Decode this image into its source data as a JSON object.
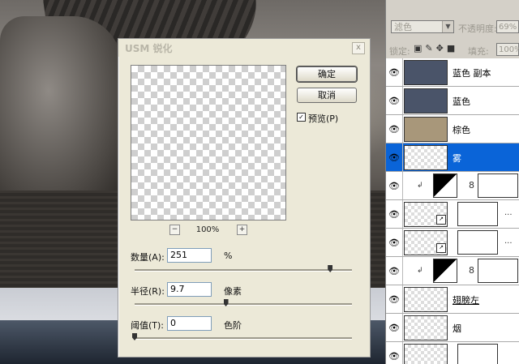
{
  "dialog": {
    "title": "USM 锐化",
    "close_label": "x",
    "ok_label": "确定",
    "cancel_label": "取消",
    "preview_label": "预览(P)",
    "preview_checked": true,
    "zoom_minus": "−",
    "zoom_plus": "+",
    "zoom_value": "100%",
    "amount": {
      "label": "数量(A):",
      "value": "251",
      "unit": "%",
      "slider_fraction": 0.9
    },
    "radius": {
      "label": "半径(R):",
      "value": "9.7",
      "unit": "像素",
      "slider_fraction": 0.42
    },
    "threshold": {
      "label": "阈值(T):",
      "value": "0",
      "unit": "色阶",
      "slider_fraction": 0.0
    }
  },
  "layers_panel": {
    "blend_mode": "滤色",
    "opacity_label": "不透明度:",
    "opacity_value": "69%",
    "lock_label": "锁定:",
    "fill_label": "填充:",
    "fill_value": "100%",
    "layers": [
      {
        "name": "蓝色 副本",
        "thumb_color": "#4a5469",
        "selected": false
      },
      {
        "name": "蓝色",
        "thumb_color": "#4a5469",
        "selected": false
      },
      {
        "name": "棕色",
        "thumb_color": "#a8977a",
        "selected": false
      },
      {
        "name": "雾",
        "thumb_color": "",
        "selected": true
      },
      {
        "name": "",
        "thumb_color": "",
        "selected": false
      },
      {
        "name": "...",
        "thumb_color": "",
        "selected": false
      },
      {
        "name": "...",
        "thumb_color": "",
        "selected": false
      },
      {
        "name": "",
        "thumb_color": "",
        "selected": false
      },
      {
        "name": "翅膀左",
        "thumb_color": "",
        "selected": false
      },
      {
        "name": "烟",
        "thumb_color": "",
        "selected": false
      },
      {
        "name": "",
        "thumb_color": "",
        "selected": false
      }
    ]
  },
  "colors": {
    "selection": "#0a64d8",
    "dialog_bg": "#ece9d8"
  }
}
